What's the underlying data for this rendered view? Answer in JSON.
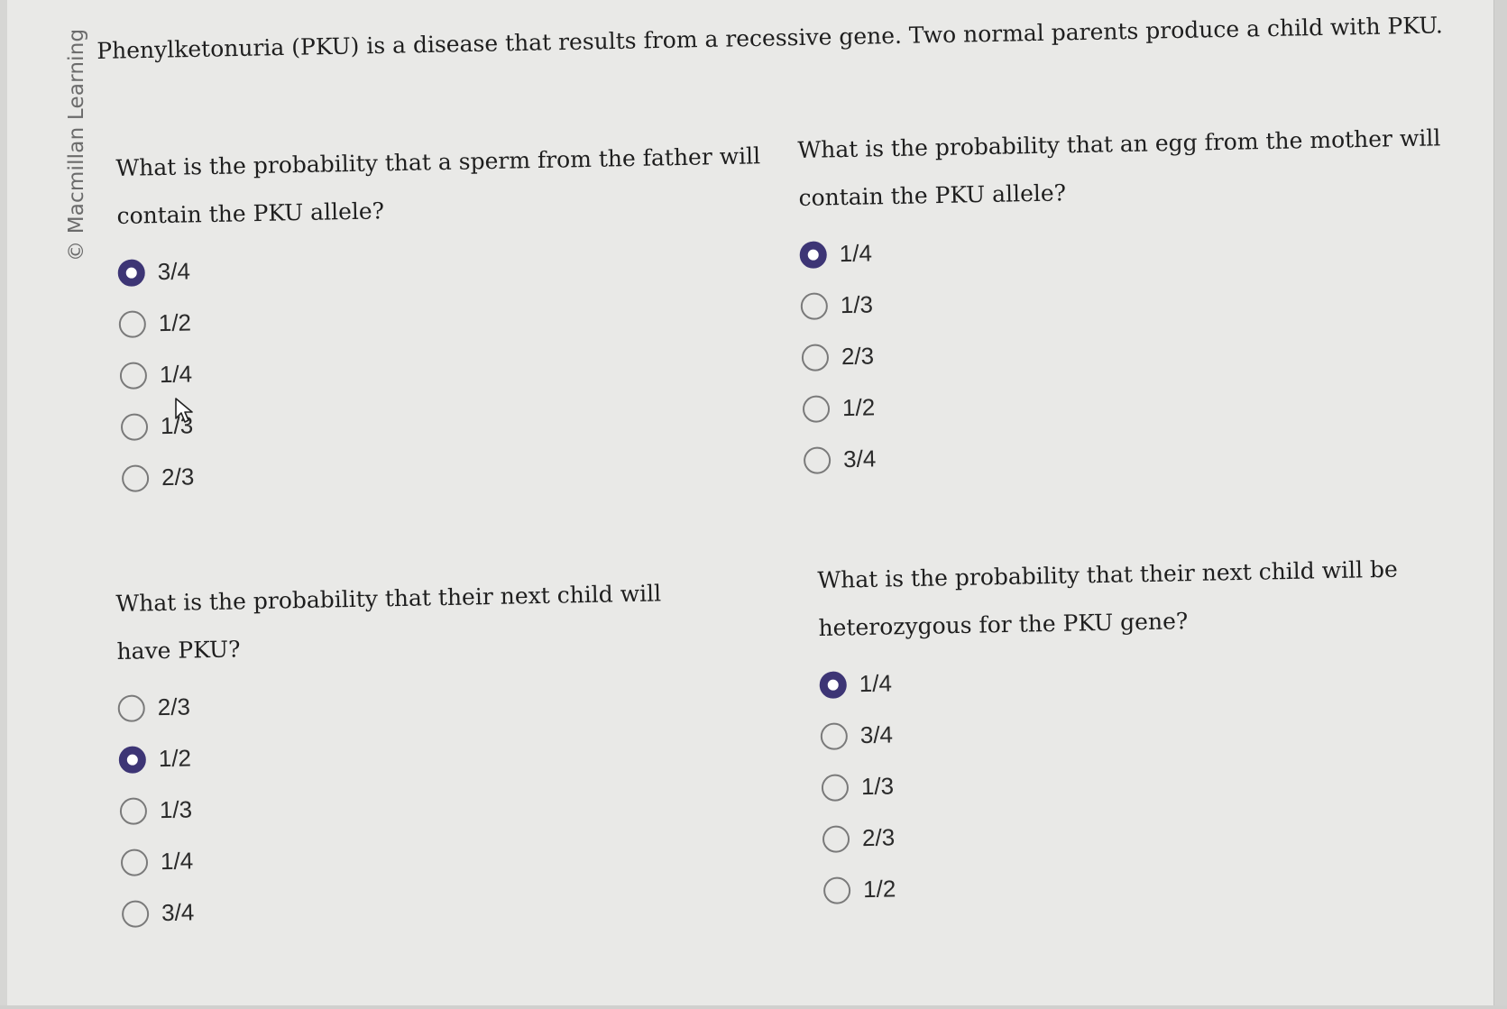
{
  "copyright": "© Macmillan Learning",
  "intro": "Phenylketonuria (PKU) is a disease that results from a recessive gene. Two normal parents produce a child with PKU.",
  "questions": [
    {
      "line1": "What is the probability that a sperm from the father will",
      "line2": "contain the PKU allele?",
      "options": [
        "3/4",
        "1/2",
        "1/4",
        "1/3",
        "2/3"
      ],
      "selected": 0
    },
    {
      "line1": "What is the probability that an egg from the mother will",
      "line2": "contain the PKU allele?",
      "options": [
        "1/4",
        "1/3",
        "2/3",
        "1/2",
        "3/4"
      ],
      "selected": 0
    },
    {
      "line1": "What is the probability that their next child will",
      "line2": "have PKU?",
      "options": [
        "2/3",
        "1/2",
        "1/3",
        "1/4",
        "3/4"
      ],
      "selected": 1
    },
    {
      "line1": "What is the probability that their next child will be",
      "line2": "heterozygous for the PKU gene?",
      "options": [
        "1/4",
        "3/4",
        "1/3",
        "2/3",
        "1/2"
      ],
      "selected": 0
    }
  ],
  "colors": {
    "selected_radio": "#3d3575",
    "background": "#e9e9e7"
  }
}
